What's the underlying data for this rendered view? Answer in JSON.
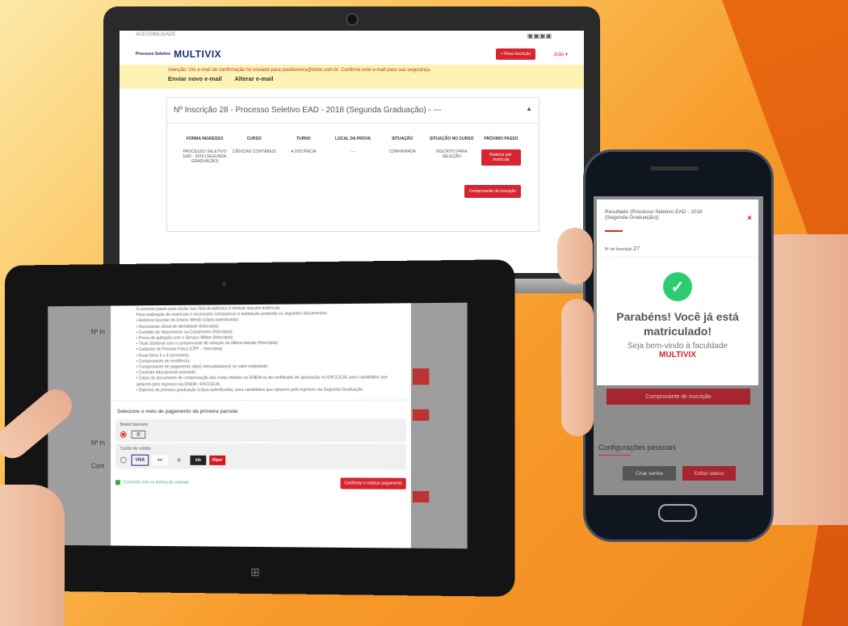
{
  "laptop": {
    "top_link": "ACESSIBILIDADE",
    "logo_small": "Processo Seletivo",
    "logo": "MULTIVIX",
    "new_btn": "+ Nova Inscrição",
    "user": "João ▾",
    "alert_text": "Atenção: Um e-mail de confirmação foi enviado para joaoteixeira@teste.com.br. Confirme este e-mail para sua segurança.",
    "resend": "Enviar novo e-mail",
    "change": "Alterar e-mail",
    "card_title": "Nº Inscrição 28 - Processo Seletivo EAD - 2018 (Segunda Graduação) - ---",
    "columns": [
      {
        "h": "FORMA INGRESSO",
        "v": "PROCESSO SELETIVO EAD - 2018 (SEGUNDA GRADUAÇÃO)"
      },
      {
        "h": "CURSO",
        "v": "CIÊNCIAS CONTÁBEIS"
      },
      {
        "h": "TURNO",
        "v": "A DISTÂNCIA"
      },
      {
        "h": "LOCAL DA PROVA",
        "v": "---"
      },
      {
        "h": "SITUAÇÃO",
        "v": "CONFIRMADA"
      },
      {
        "h": "SITUAÇÃO NO CURSO",
        "v": "INSCRITO PARA SELEÇÃO"
      }
    ],
    "next_step_h": "PRÓXIMO PASSO",
    "next_step_btn": "Realizar pré-matrícula",
    "receipt_btn": "Comprovante de inscrição"
  },
  "tablet": {
    "side_label": "Nº In",
    "docs": [
      "O próximo passo para iniciar sua Vida Acadêmica é efetivar sua pré-matrícula.",
      "Para realização da matrícula é necessário comparecer à instituição portando os seguintes documentos:",
      "• Histórico Escolar do Ensino Médio (cópia autenticada);",
      "• Documento oficial de identidade (fotocópia);",
      "• Certidão de Nascimento ou Casamento (fotocópia);",
      "• Prova de quitação com o Serviço Militar (fotocópia);",
      "• Título Eleitoral com o comprovante de votação da última eleição (fotocópia);",
      "• Cadastro de Pessoa Física (CPF – fotocópia);",
      "• Duas fotos 3 x 4 (recentes);",
      "• Comprovante de residência;",
      "• Comprovante de pagamento da(s) mensalidade(s) no valor estipulado;",
      "• Contrato educacional assinado;",
      "• Cópia do documento de comprovação das notas obtidas no ENEM ou do certificado de aprovação no ENCCEJA, para candidatos que optarem pelo ingresso via ENEM / ENCCEJA;",
      "• Diploma da primeira graduação (cópia autenticada), para candidatos que optarem pelo ingresso via Segunda Graduação."
    ],
    "pay_title": "Selecione o meio de pagamento da primeira parcela:",
    "boleto": "Boleto bancário",
    "boleto_icon": "barcode-icon",
    "cartao": "Cartão de crédito",
    "cards": [
      "VISA",
      "MC",
      "Diners",
      "elo",
      "Hiper"
    ],
    "agree": "Concordo com os termos do contrato",
    "confirm": "Confirmar e realizar pagamento",
    "bg_label_1": "Nº In",
    "bg_label_2": "Cont"
  },
  "phone": {
    "title": "Resultado (Processo Seletivo EAD - 2018 (Segunda Graduação))",
    "close": "×",
    "insc_label": "Nº de Inscrição",
    "insc_value": "27",
    "congrats": "Parabéns! Você já está matriculado!",
    "welcome": "Seja bem-vindo à faculdade",
    "brand": "MULTIVIX",
    "receipt": "Comprovante de inscrição",
    "config": "Configurações pessoais",
    "btn_password": "Criar senha",
    "btn_edit": "Editar dados"
  },
  "colors": {
    "accent": "#d62430",
    "success": "#2ecc71",
    "background": "#f79a2a"
  }
}
